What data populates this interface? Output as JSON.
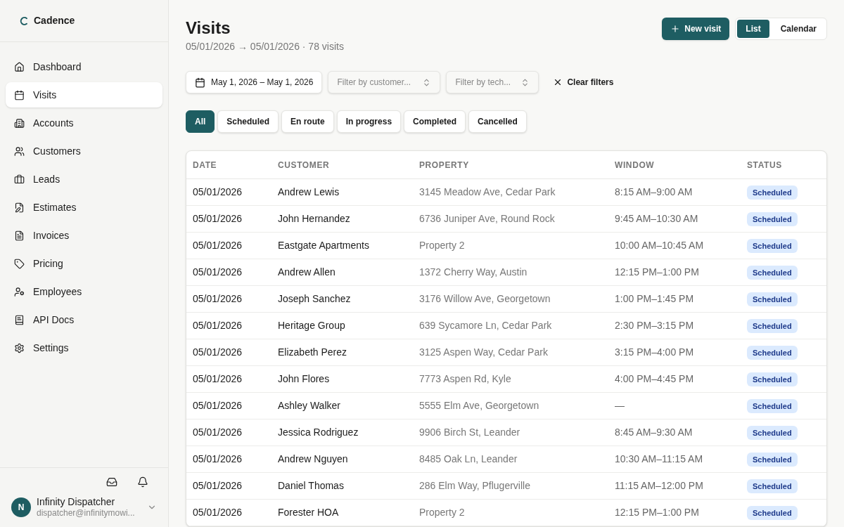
{
  "brand": "Cadence",
  "nav": [
    {
      "label": "Dashboard",
      "kind": "home",
      "selected": false
    },
    {
      "label": "Visits",
      "kind": "calendar",
      "selected": true
    },
    {
      "label": "Accounts",
      "kind": "building",
      "selected": false
    },
    {
      "label": "Customers",
      "kind": "users",
      "selected": false
    },
    {
      "label": "Leads",
      "kind": "briefcase",
      "selected": false
    },
    {
      "label": "Estimates",
      "kind": "estimate",
      "selected": false
    },
    {
      "label": "Invoices",
      "kind": "invoice",
      "selected": false
    },
    {
      "label": "Pricing",
      "kind": "pricing",
      "selected": false
    },
    {
      "label": "Employees",
      "kind": "employees",
      "selected": false
    },
    {
      "label": "API Docs",
      "kind": "docs",
      "selected": false
    },
    {
      "label": "Settings",
      "kind": "settings",
      "selected": false
    }
  ],
  "user": {
    "initial": "N",
    "name": "Infinity Dispatcher",
    "email": "dispatcher@infinitymowi..."
  },
  "page": {
    "title": "Visits",
    "subtitle": "05/01/2026 → 05/01/2026 · 78 visits",
    "new_button": "New visit"
  },
  "views": [
    {
      "label": "List",
      "selected": true
    },
    {
      "label": "Calendar",
      "selected": false
    }
  ],
  "filters": {
    "date_range": "May 1, 2026 – May 1, 2026",
    "customer_placeholder": "Filter by customer...",
    "tech_placeholder": "Filter by tech...",
    "clear": "Clear filters"
  },
  "status_tabs": [
    {
      "label": "All",
      "selected": true
    },
    {
      "label": "Scheduled",
      "selected": false
    },
    {
      "label": "En route",
      "selected": false
    },
    {
      "label": "In progress",
      "selected": false
    },
    {
      "label": "Completed",
      "selected": false
    },
    {
      "label": "Cancelled",
      "selected": false
    }
  ],
  "table": {
    "columns": [
      "DATE",
      "CUSTOMER",
      "PROPERTY",
      "WINDOW",
      "STATUS"
    ],
    "rows": [
      {
        "date": "05/01/2026",
        "customer": "Andrew Lewis",
        "property": "3145 Meadow Ave, Cedar Park",
        "window": "8:15 AM–9:00 AM",
        "status": "Scheduled",
        "kind": "scheduled"
      },
      {
        "date": "05/01/2026",
        "customer": "John Hernandez",
        "property": "6736 Juniper Ave, Round Rock",
        "window": "9:45 AM–10:30 AM",
        "status": "Scheduled",
        "kind": "scheduled"
      },
      {
        "date": "05/01/2026",
        "customer": "Eastgate Apartments",
        "property": "Property 2",
        "window": "10:00 AM–10:45 AM",
        "status": "Scheduled",
        "kind": "scheduled"
      },
      {
        "date": "05/01/2026",
        "customer": "Andrew Allen",
        "property": "1372 Cherry Way, Austin",
        "window": "12:15 PM–1:00 PM",
        "status": "Scheduled",
        "kind": "scheduled"
      },
      {
        "date": "05/01/2026",
        "customer": "Joseph Sanchez",
        "property": "3176 Willow Ave, Georgetown",
        "window": "1:00 PM–1:45 PM",
        "status": "Scheduled",
        "kind": "scheduled"
      },
      {
        "date": "05/01/2026",
        "customer": "Heritage Group",
        "property": "639 Sycamore Ln, Cedar Park",
        "window": "2:30 PM–3:15 PM",
        "status": "Scheduled",
        "kind": "scheduled"
      },
      {
        "date": "05/01/2026",
        "customer": "Elizabeth Perez",
        "property": "3125 Aspen Way, Cedar Park",
        "window": "3:15 PM–4:00 PM",
        "status": "Scheduled",
        "kind": "scheduled"
      },
      {
        "date": "05/01/2026",
        "customer": "John Flores",
        "property": "7773 Aspen Rd, Kyle",
        "window": "4:00 PM–4:45 PM",
        "status": "Scheduled",
        "kind": "scheduled"
      },
      {
        "date": "05/01/2026",
        "customer": "Ashley Walker",
        "property": "5555 Elm Ave, Georgetown",
        "window": "—",
        "status": "Scheduled",
        "kind": "scheduled"
      },
      {
        "date": "05/01/2026",
        "customer": "Jessica Rodriguez",
        "property": "9906 Birch St, Leander",
        "window": "8:45 AM–9:30 AM",
        "status": "Scheduled",
        "kind": "scheduled"
      },
      {
        "date": "05/01/2026",
        "customer": "Andrew Nguyen",
        "property": "8485 Oak Ln, Leander",
        "window": "10:30 AM–11:15 AM",
        "status": "Scheduled",
        "kind": "scheduled"
      },
      {
        "date": "05/01/2026",
        "customer": "Daniel Thomas",
        "property": "286 Elm Way, Pflugerville",
        "window": "11:15 AM–12:00 PM",
        "status": "Scheduled",
        "kind": "scheduled"
      },
      {
        "date": "05/01/2026",
        "customer": "Forester HOA",
        "property": "Property 2",
        "window": "12:15 PM–1:00 PM",
        "status": "Scheduled",
        "kind": "scheduled"
      }
    ]
  }
}
